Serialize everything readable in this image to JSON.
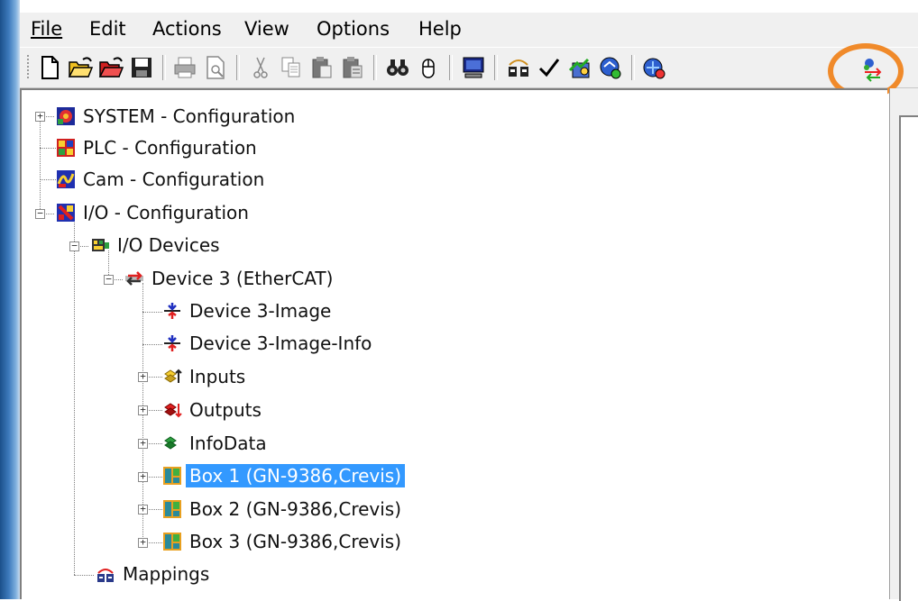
{
  "menu": {
    "items": [
      {
        "label": "File"
      },
      {
        "label": "Edit"
      },
      {
        "label": "Actions"
      },
      {
        "label": "View"
      },
      {
        "label": "Options"
      },
      {
        "label": "Help"
      }
    ]
  },
  "toolbar": {
    "buttons": [
      "new-file-icon",
      "open-file-icon",
      "open-project-icon",
      "save-icon",
      "print-icon",
      "print-preview-icon",
      "cut-icon",
      "copy-icon",
      "paste-icon",
      "paste-with-links-icon",
      "find-icon",
      "mouse-icon",
      "monitor-icon",
      "generate-mappings-icon",
      "check-configuration-icon",
      "activate-configuration-icon",
      "set-run-mode-icon",
      "config-mode-icon",
      "reload-devices-icon"
    ],
    "highlight_color": "#f08a2a"
  },
  "tree": {
    "system": "SYSTEM - Configuration",
    "plc": "PLC - Configuration",
    "cam": "Cam - Configuration",
    "io": "I/O - Configuration",
    "io_devices": "I/O Devices",
    "device3": "Device 3 (EtherCAT)",
    "device3_image": "Device 3-Image",
    "device3_image_info": "Device 3-Image-Info",
    "inputs": "Inputs",
    "outputs": "Outputs",
    "infodata": "InfoData",
    "box1": "Box 1 (GN-9386,Crevis)",
    "box2": "Box 2 (GN-9386,Crevis)",
    "box3": "Box 3 (GN-9386,Crevis)",
    "mappings": "Mappings",
    "selected": "Box 1 (GN-9386,Crevis)",
    "selection_color": "#3399ff"
  }
}
